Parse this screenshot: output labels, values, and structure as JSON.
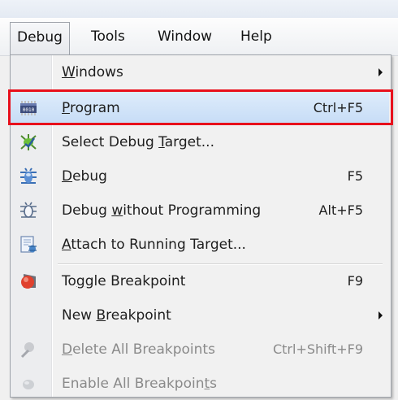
{
  "menubar": {
    "items": [
      {
        "label": "Debug"
      },
      {
        "label": "Tools"
      },
      {
        "label": "Window"
      },
      {
        "label": "Help"
      }
    ]
  },
  "menu": {
    "items": [
      {
        "pre": "",
        "ul": "W",
        "post": "indows",
        "shortcut": "",
        "submenu": true,
        "icon": "none"
      },
      {
        "pre": "",
        "ul": "P",
        "post": "rogram",
        "shortcut": "Ctrl+F5",
        "icon": "chip-icon",
        "highlight": true
      },
      {
        "pre": "Select Debug ",
        "ul": "T",
        "post": "arget...",
        "shortcut": "",
        "icon": "target-bug-icon"
      },
      {
        "pre": "",
        "ul": "D",
        "post": "ebug",
        "shortcut": "F5",
        "icon": "bug-icon"
      },
      {
        "pre": "Debug ",
        "ul": "w",
        "post": "ithout Programming",
        "shortcut": "Alt+F5",
        "icon": "bug-outline-icon"
      },
      {
        "pre": "",
        "ul": "A",
        "post": "ttach to Running Target...",
        "shortcut": "",
        "icon": "attach-icon"
      },
      {
        "pre": "To",
        "ul": "g",
        "post": "gle Breakpoint",
        "shortcut": "F9",
        "icon": "breakpoint-icon"
      },
      {
        "pre": "New ",
        "ul": "B",
        "post": "reakpoint",
        "shortcut": "",
        "submenu": true,
        "icon": "none"
      },
      {
        "pre": "",
        "ul": "D",
        "post": "elete All Breakpoints",
        "shortcut": "Ctrl+Shift+F9",
        "icon": "delete-breakpoints-icon",
        "disabled": true
      },
      {
        "pre": "Enable All Breakpoin",
        "ul": "t",
        "post": "s",
        "shortcut": "",
        "icon": "enable-breakpoints-icon",
        "disabled": true
      }
    ]
  }
}
